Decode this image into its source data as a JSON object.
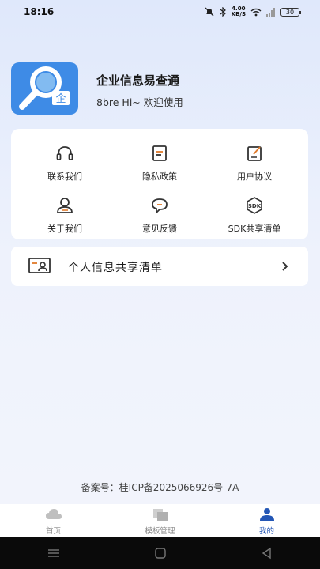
{
  "status_bar": {
    "time": "18:16",
    "net_speed_value": "4.00",
    "net_speed_unit": "KB/S",
    "battery": "30"
  },
  "app": {
    "name": "企业信息易查通",
    "greeting": "8bre Hi~ 欢迎使用",
    "logo_badge": "企",
    "accent_color": "#3e8be6"
  },
  "menu": {
    "items": [
      {
        "label": "联系我们",
        "icon": "headset-icon"
      },
      {
        "label": "隐私政策",
        "icon": "document-icon"
      },
      {
        "label": "用户协议",
        "icon": "edit-icon"
      },
      {
        "label": "关于我们",
        "icon": "user-icon"
      },
      {
        "label": "意见反馈",
        "icon": "chat-icon"
      },
      {
        "label": "SDK共享清单",
        "icon": "sdk-icon",
        "badge": "SDK"
      }
    ]
  },
  "share_list": {
    "label": "个人信息共享清单",
    "icon": "id-card-icon"
  },
  "footer": {
    "icp": "备案号：桂ICP备2025066926号-7A"
  },
  "tabs": [
    {
      "label": "首页",
      "icon": "cloud-icon",
      "active": false
    },
    {
      "label": "模板管理",
      "icon": "layers-icon",
      "active": false
    },
    {
      "label": "我的",
      "icon": "profile-icon",
      "active": true
    }
  ],
  "colors": {
    "active_tab": "#2356b5",
    "inactive_tab": "#888888"
  }
}
